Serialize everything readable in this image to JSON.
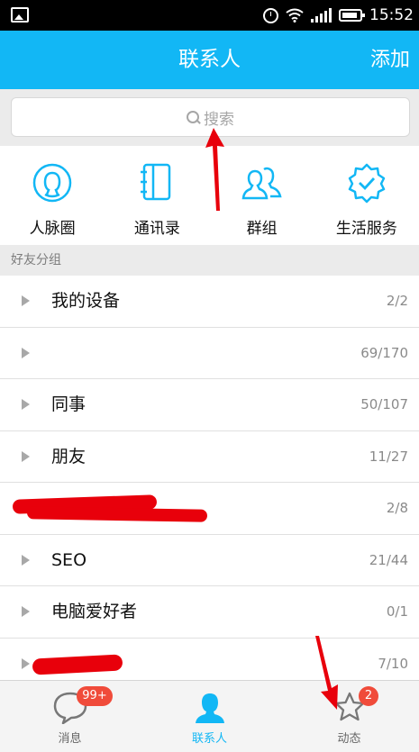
{
  "status_bar": {
    "time": "15:52"
  },
  "header": {
    "title": "联系人",
    "add_label": "添加"
  },
  "search": {
    "placeholder": "搜索"
  },
  "quick_entries": [
    {
      "label": "人脉圈",
      "icon": "circle-person-icon"
    },
    {
      "label": "通讯录",
      "icon": "address-book-icon"
    },
    {
      "label": "群组",
      "icon": "group-icon"
    },
    {
      "label": "生活服务",
      "icon": "service-badge-icon"
    }
  ],
  "section": {
    "title": "好友分组"
  },
  "groups": [
    {
      "name": "我的设备",
      "count": "2/2"
    },
    {
      "name": "",
      "count": "69/170"
    },
    {
      "name": "同事",
      "count": "50/107"
    },
    {
      "name": "朋友",
      "count": "11/27"
    },
    {
      "name": "",
      "count": "2/8"
    },
    {
      "name": "SEO",
      "count": "21/44"
    },
    {
      "name": "电脑爱好者",
      "count": "0/1"
    },
    {
      "name": "",
      "count": "7/10"
    }
  ],
  "tabs": [
    {
      "label": "消息",
      "badge": "99+"
    },
    {
      "label": "联系人",
      "badge": ""
    },
    {
      "label": "动态",
      "badge": "2"
    }
  ],
  "colors": {
    "accent": "#12b7f5",
    "badge": "#f04b3a",
    "annotation": "#e8000b"
  }
}
